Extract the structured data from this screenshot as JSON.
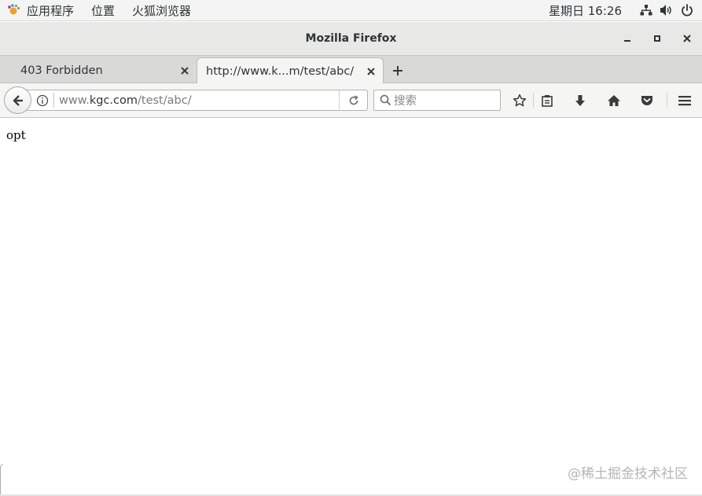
{
  "topbar": {
    "apps_label": "应用程序",
    "places_label": "位置",
    "app_label": "火狐浏览器",
    "clock": "星期日 16:26",
    "icons": [
      "network-icon",
      "volume-icon",
      "power-icon"
    ]
  },
  "window": {
    "title": "Mozilla Firefox",
    "controls": [
      "minimize-icon",
      "maximize-icon",
      "close-icon"
    ]
  },
  "tabs": [
    {
      "title": "403 Forbidden",
      "active": false
    },
    {
      "title": "http://www.k...m/test/abc/",
      "active": true
    }
  ],
  "urlbar": {
    "prefix": "www.",
    "domain": "kgc.com",
    "path": "/test/abc/"
  },
  "searchbar": {
    "placeholder": "搜索"
  },
  "content": {
    "text": "opt"
  },
  "watermark": "@稀土掘金技术社区",
  "colors": {
    "topbar_bg": "#f4f4f4",
    "titlebar_bg": "#e8e8e7",
    "tabstrip_bg": "#d9d9d8",
    "toolbar_bg": "#f5f5f4",
    "icon": "#3b3b3b"
  }
}
